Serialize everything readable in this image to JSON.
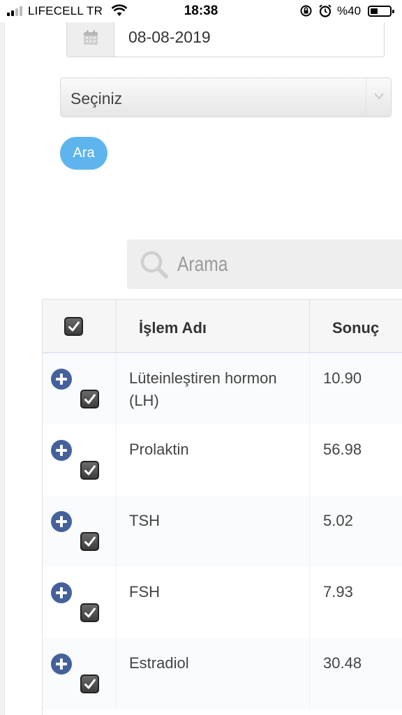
{
  "status_bar": {
    "carrier": "LIFECELL TR",
    "time": "18:38",
    "battery_percent": "%40",
    "battery_level": 0.4
  },
  "form": {
    "date_value": "08-08-2019",
    "select_value": "Seçiniz",
    "search_button_label": "Ara"
  },
  "search": {
    "placeholder": "Arama"
  },
  "table": {
    "headers": {
      "select_all_checked": true,
      "name": "İşlem Adı",
      "result": "Sonuç"
    },
    "rows": [
      {
        "name": "Lüteinleştiren hormon (LH)",
        "result": "10.90",
        "checked": true
      },
      {
        "name": "Prolaktin",
        "result": "56.98",
        "checked": true
      },
      {
        "name": "TSH",
        "result": "5.02",
        "checked": true
      },
      {
        "name": "FSH",
        "result": "7.93",
        "checked": true
      },
      {
        "name": "Estradiol",
        "result": "30.48",
        "checked": true
      }
    ]
  },
  "colors": {
    "button_blue": "#5eb5ee",
    "plus_icon": "#44619b",
    "checkbox": "#3d3d3d"
  }
}
